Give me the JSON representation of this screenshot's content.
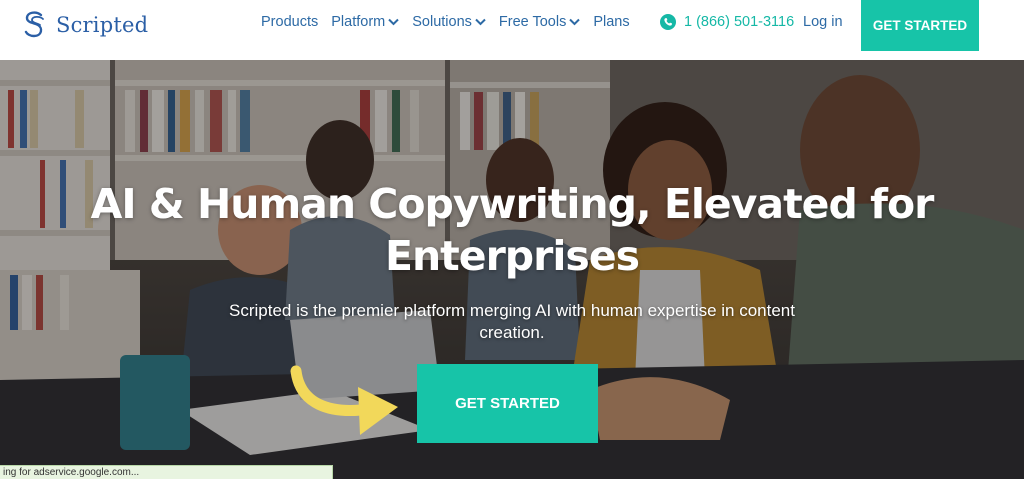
{
  "brand": {
    "name": "Scripted",
    "color": "#2b5fa6",
    "accent": "#17c4a8"
  },
  "nav": {
    "items": [
      {
        "label": "Products",
        "dropdown": false
      },
      {
        "label": "Platform",
        "dropdown": true
      },
      {
        "label": "Solutions",
        "dropdown": true
      },
      {
        "label": "Free Tools",
        "dropdown": true
      },
      {
        "label": "Plans",
        "dropdown": false
      }
    ],
    "phone": "1 (866) 501-3116",
    "login": "Log in",
    "cta": "GET STARTED"
  },
  "hero": {
    "title_line1": "AI & Human Copywriting, Elevated for",
    "title_line2": "Enterprises",
    "subtitle": "Scripted is the premier platform merging AI with human expertise in content creation.",
    "cta": "GET STARTED",
    "arrow_color": "#f2d85a"
  },
  "status_bar": {
    "text": "ing for adservice.google.com..."
  }
}
